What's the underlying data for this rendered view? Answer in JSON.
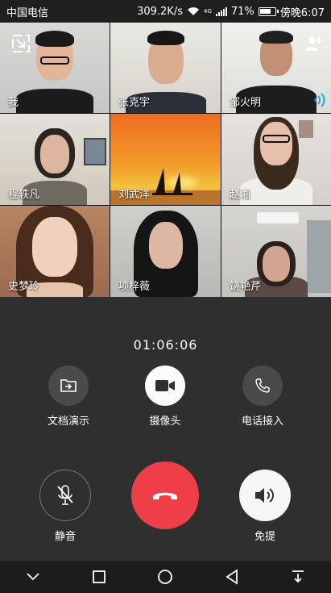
{
  "status_bar": {
    "carrier": "中国电信",
    "speed": "309.2K/s",
    "network": "4G",
    "battery": "71%",
    "time": "傍晚6:07"
  },
  "participants": [
    {
      "name": "我"
    },
    {
      "name": "张克宇"
    },
    {
      "name": "邹火明"
    },
    {
      "name": "程轶凡"
    },
    {
      "name": "刘武洋"
    },
    {
      "name": "赵湘"
    },
    {
      "name": "史梦玲"
    },
    {
      "name": "项梓薇"
    },
    {
      "name": "饶艳芹"
    }
  ],
  "call": {
    "timer": "01:06:06",
    "actions": {
      "screen_share": "文档演示",
      "camera": "摄像头",
      "phone_dialin": "电话接入",
      "mute": "静音",
      "speaker": "免提"
    }
  },
  "colors": {
    "hangup": "#ee3f48",
    "speaking_indicator": "#2aa3e8",
    "background": "#2f2f2f"
  },
  "icons": {
    "minimize": "minimize-window-icon",
    "add_member": "add-person-icon",
    "speaking": "speaking-wave-icon",
    "share": "folder-share-icon",
    "camera": "video-camera-icon",
    "phone": "phone-icon",
    "mute": "mic-off-icon",
    "hangup": "hang-up-icon",
    "speaker": "speaker-icon"
  }
}
